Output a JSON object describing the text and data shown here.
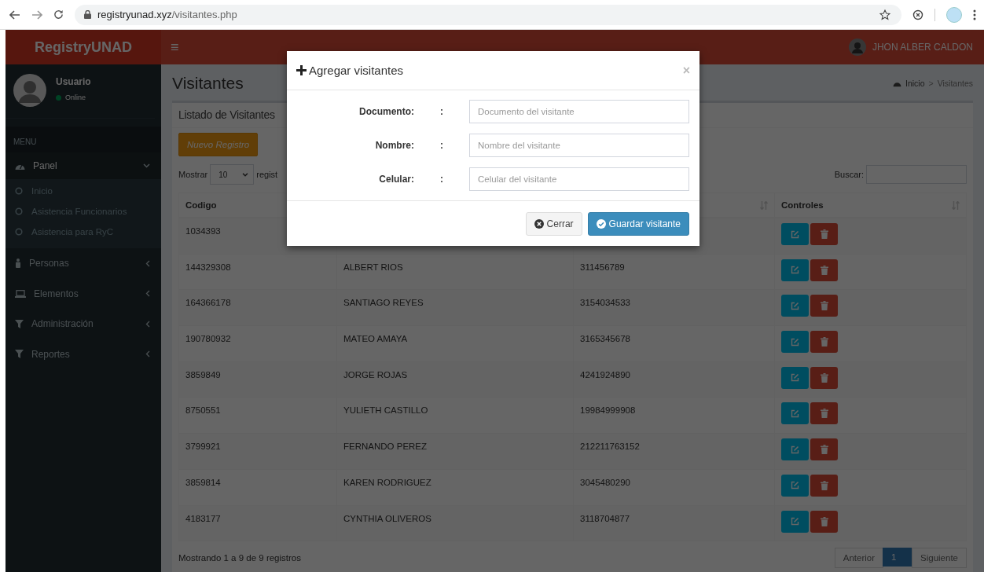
{
  "browser": {
    "url_host": "registryunad.xyz",
    "url_path": "/visitantes.php"
  },
  "header": {
    "logo": "RegistryUNAD",
    "menu_toggle": "≡",
    "user_name": "JHON ALBER CALDON"
  },
  "sidebar": {
    "user": {
      "name": "Usuario",
      "status": "Online",
      "online": true
    },
    "section_label": "MENU",
    "items": [
      {
        "label": "Panel",
        "expanded": true,
        "children": [
          {
            "label": "Inicio"
          },
          {
            "label": "Asistencia Funcionarios"
          },
          {
            "label": "Asistencia para RyC"
          }
        ]
      },
      {
        "label": "Personas",
        "expanded": false
      },
      {
        "label": "Elementos",
        "expanded": false
      },
      {
        "label": "Administración",
        "expanded": false
      },
      {
        "label": "Reportes",
        "expanded": false
      }
    ]
  },
  "page": {
    "title": "Visitantes",
    "breadcrumb": [
      "Inicio",
      "Visitantes"
    ],
    "breadcrumb_separator": ">"
  },
  "box": {
    "title": "Listado de Visitantes",
    "new_button": "Nuevo Registro",
    "show_label": "Mostrar",
    "page_size": "10",
    "show_suffix": "regist",
    "search_label": "Buscar:"
  },
  "table": {
    "columns": [
      "Codigo",
      "",
      "",
      "Controles"
    ],
    "rows": [
      {
        "code": "1034393"
      },
      {
        "code": "144329308",
        "name": "ALBERT RIOS",
        "phone": "311456789"
      },
      {
        "code": "164366178",
        "name": "SANTIAGO REYES",
        "phone": "3154034533"
      },
      {
        "code": "190780932",
        "name": "MATEO AMAYA",
        "phone": "3165345678"
      },
      {
        "code": "3859849",
        "name": "JORGE ROJAS",
        "phone": "4241924890"
      },
      {
        "code": "8750551",
        "name": "YULIETH CASTILLO",
        "phone": "19984999908"
      },
      {
        "code": "3799921",
        "name": "FERNANDO PEREZ",
        "phone": "212211763152"
      },
      {
        "code": "3859814",
        "name": "KAREN RODRIGUEZ",
        "phone": "3045480290"
      },
      {
        "code": "4183177",
        "name": "CYNTHIA OLIVEROS",
        "phone": "3118704877"
      }
    ]
  },
  "footer": {
    "info": "Mostrando 1 a 9 de 9 registros",
    "pages": [
      {
        "label": "Anterior",
        "selected": false
      },
      {
        "label": "1",
        "selected": true
      },
      {
        "label": "Siguiente",
        "selected": false
      }
    ]
  },
  "modal": {
    "title": "Agregar visitantes",
    "close": "×",
    "fields": [
      {
        "label": "Documento:",
        "colon": ":",
        "placeholder": "Documento del visitante"
      },
      {
        "label": "Nombre:",
        "colon": ":",
        "placeholder": "Nombre del visitante"
      },
      {
        "label": "Celular:",
        "colon": ":",
        "placeholder": "Celular del visitante"
      }
    ],
    "buttons": [
      "Cerrar",
      "Guardar visitante"
    ]
  }
}
